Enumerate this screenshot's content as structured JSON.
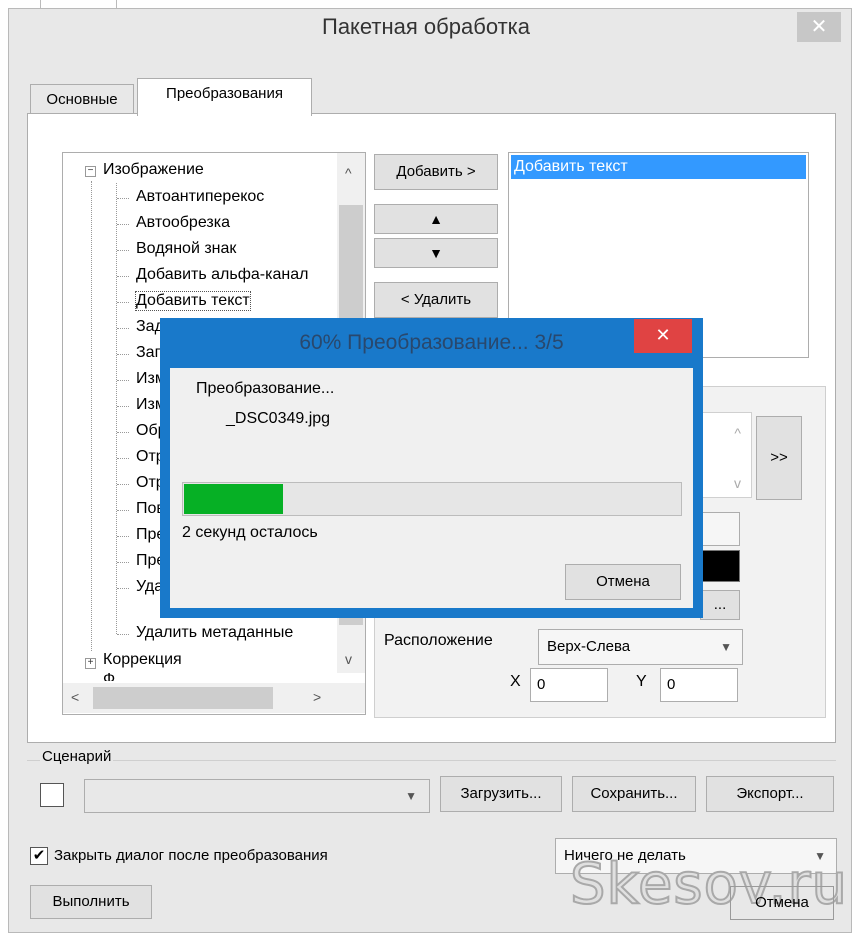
{
  "window": {
    "title": "Пакетная обработка",
    "close_icon": "close-icon"
  },
  "tabs": [
    {
      "label": "Основные",
      "active": false
    },
    {
      "label": "Преобразования",
      "active": true
    }
  ],
  "tree": {
    "root_label": "Изображение",
    "items": [
      "Автоантиперекос",
      "Автообрезка",
      "Водяной знак",
      "Добавить альфа-канал",
      "Добавить текст",
      "Зад",
      "Зап",
      "Изм",
      "Изм",
      "Обр",
      "Отр",
      "Отр",
      "Пов",
      "Пре",
      "Пре",
      "Удал",
      "Удалить метаданные"
    ],
    "sibling": "Коррекция",
    "sibling2": "Ф"
  },
  "buttons": {
    "add": "Добавить >",
    "remove": "< Удалить",
    "more": ">>",
    "load": "Загрузить...",
    "save": "Сохранить...",
    "export": "Экспорт...",
    "run": "Выполнить",
    "cancel": "Отмена",
    "browse": "..."
  },
  "selected_list": [
    "Добавить текст"
  ],
  "props": {
    "position_label": "Расположение",
    "position_value": "Верх-Слева",
    "x_label": "X",
    "x_value": "0",
    "y_label": "Y",
    "y_value": "0",
    "text_color": "#000000"
  },
  "scenario": {
    "label": "Сценарий",
    "value": ""
  },
  "footer": {
    "close_after_label": "Закрыть диалог после преобразования",
    "close_after_checked": true,
    "after_action": "Ничего не делать",
    "check_mark": "✔"
  },
  "progress": {
    "title": "60% Преобразование...  3/5",
    "status": "Преобразование...",
    "file": "_DSC0349.jpg",
    "time_left": "2 секунд осталось",
    "cancel": "Отмена",
    "fraction": 0.2
  },
  "watermark": "Skesov.ru",
  "colors": {
    "selection": "#3399ff",
    "progress_fill": "#06b025",
    "dialog_frame": "#1979ca",
    "dialog_close": "#e04343"
  }
}
